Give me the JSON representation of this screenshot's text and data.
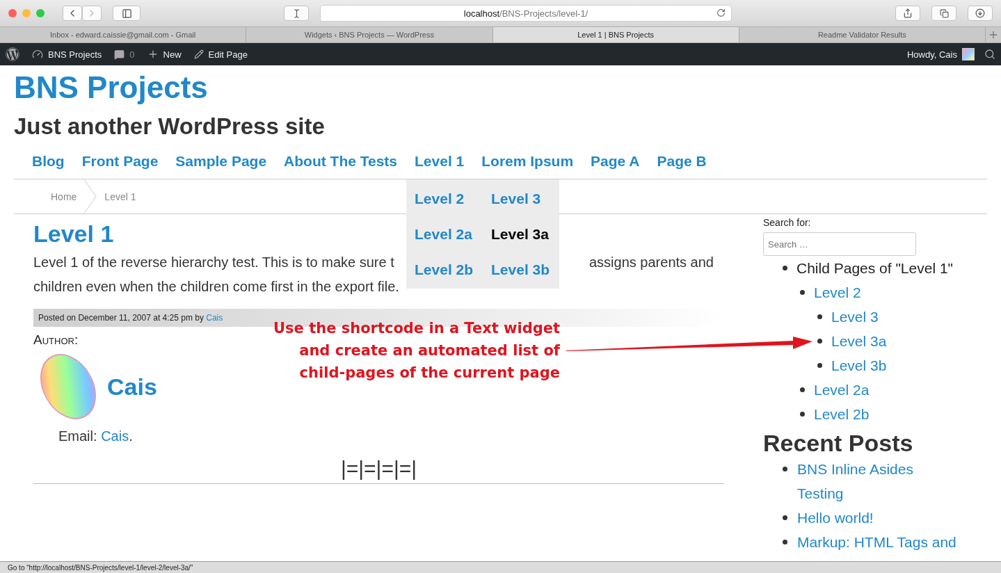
{
  "browser": {
    "address": {
      "host": "localhost",
      "path": "/BNS-Projects/level-1/"
    },
    "tabs": [
      {
        "label": "Inbox - edward.caissie@gmail.com - Gmail",
        "selected": false
      },
      {
        "label": "Widgets ‹ BNS Projects — WordPress",
        "selected": false
      },
      {
        "label": "Level 1 | BNS Projects",
        "selected": true
      },
      {
        "label": "Readme Validator Results",
        "selected": false
      }
    ]
  },
  "admin_bar": {
    "site": "BNS Projects",
    "comments": "0",
    "new": "New",
    "edit": "Edit Page",
    "greeting": "Howdy, Cais"
  },
  "site": {
    "title": "BNS Projects",
    "tagline": "Just another WordPress site"
  },
  "nav": [
    {
      "label": "Blog"
    },
    {
      "label": "Front Page"
    },
    {
      "label": "Sample Page"
    },
    {
      "label": "About The Tests"
    },
    {
      "label": "Level 1",
      "columns": [
        [
          {
            "label": "Level 2",
            "selected": false
          },
          {
            "label": "Level 2a",
            "selected": false
          },
          {
            "label": "Level 2b",
            "selected": false
          }
        ],
        [
          {
            "label": "Level 3",
            "selected": false
          },
          {
            "label": "Level 3a",
            "selected": true
          },
          {
            "label": "Level 3b",
            "selected": false
          }
        ]
      ]
    },
    {
      "label": "Lorem Ipsum"
    },
    {
      "label": "Page A"
    },
    {
      "label": "Page B"
    }
  ],
  "breadcrumb": [
    "Home",
    "Level 1"
  ],
  "post": {
    "title": "Level 1",
    "line_1_parts": [
      "Level 1 of the reverse hierarchy test. This is to make sure t",
      "assigns parents and"
    ],
    "line_2": "children even when the children come first in the export file.",
    "meta_prefix": "Posted on December 11, 2007 at 4:25 pm by",
    "meta_author": "Cais",
    "author_label": "Author:",
    "author_name": "Cais",
    "email_label": "Email:",
    "email_link": "Cais",
    "email_end": ".",
    "separator": "|=|=|=|=|"
  },
  "annotation": [
    "Use the shortcode in a Text widget",
    "and create an automated list of",
    "child-pages of the current page"
  ],
  "sidebar": {
    "search_label": "Search for:",
    "search_placeholder": "Search …",
    "child_pages": {
      "title": "Child Pages of \"Level 1\"",
      "children": [
        {
          "label": "Level 2",
          "children": [
            {
              "label": "Level 3"
            },
            {
              "label": "Level 3a"
            },
            {
              "label": "Level 3b"
            }
          ]
        },
        {
          "label": "Level 2a"
        },
        {
          "label": "Level 2b"
        }
      ]
    },
    "recent_title": "Recent Posts",
    "recent_posts": [
      "BNS Inline Asides Testing",
      "Hello world!",
      "Markup: HTML Tags and"
    ]
  },
  "status_bar": "Go to “http://localhost/BNS-Projects/level-1/level-2/level-3a/”"
}
